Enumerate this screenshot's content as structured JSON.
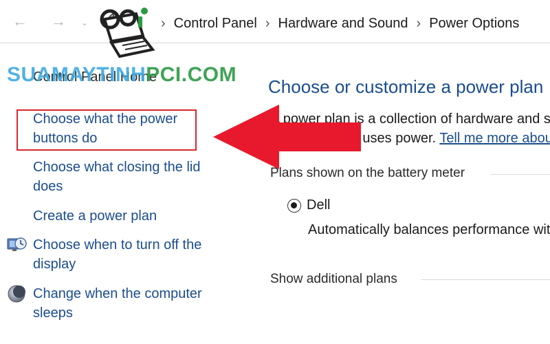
{
  "address_bar": {
    "back": "←",
    "forward": "→",
    "recent": "⌄",
    "breadcrumbs": [
      "Control Panel",
      "Hardware and Sound",
      "Power Options"
    ],
    "separator": "›"
  },
  "watermark": {
    "text_part1": "SUAMAYTINH",
    "text_part2": "PCI.COM",
    "colors": {
      "primary": "#3fa9e0",
      "secondary": "#2b9a44"
    }
  },
  "left_pane": {
    "home_link": "Control Panel Home",
    "tasks": [
      {
        "label": "Choose what the power buttons do"
      },
      {
        "label": "Choose what closing the lid does"
      },
      {
        "label": "Create a power plan"
      },
      {
        "label": "Choose when to turn off the display",
        "icon": "display-timer-icon"
      },
      {
        "label": "Change when the computer sleeps",
        "icon": "sleep-moon-icon"
      }
    ]
  },
  "annotation": {
    "highlight_color": "#d7282e",
    "arrow_color": "#e8192c"
  },
  "main": {
    "title": "Choose or customize a power plan",
    "intro": "A power plan is a collection of hardware and system settings that manages how",
    "intro_line2": "your computer uses power. ",
    "intro_link": "Tell me more about power plans",
    "group_battery": "Plans shown on the battery meter",
    "plan_name": "Dell",
    "plan_desc": "Automatically balances performance with energy consumption",
    "group_additional": "Show additional plans"
  },
  "colors": {
    "link": "#1a4d8f",
    "text": "#1a1a1a",
    "border": "#d9d9d9"
  }
}
